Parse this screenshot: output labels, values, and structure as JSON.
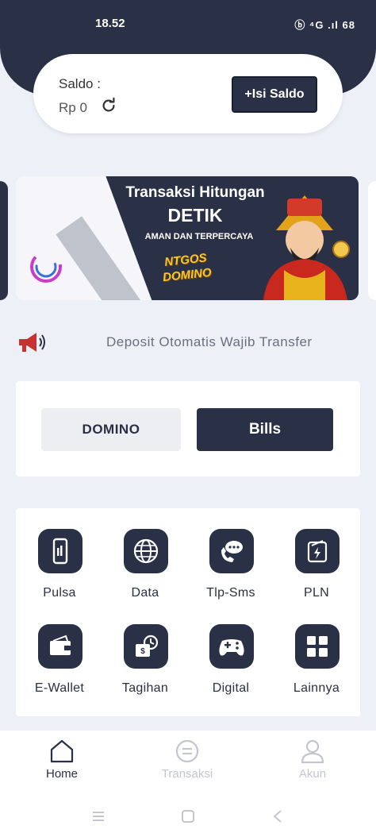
{
  "status_bar": {
    "time": "18.52",
    "icons": "ⓑ ⁴G .ıl 68"
  },
  "saldo": {
    "label": "Saldo :",
    "value": "Rp 0",
    "refresh_icon": "refresh-icon",
    "topup_label": "+Isi Saldo"
  },
  "banner": {
    "title": "Transaksi Hitungan",
    "highlight": "DETIK",
    "subtitle": "AMAN DAN TERPERCAYA",
    "brand_line1": "NTGOS",
    "brand_line2": "DOMINO",
    "accent_color": "#f6c531"
  },
  "announcement": {
    "icon": "megaphone-icon",
    "text": "Deposit Otomatis Wajib Transfer"
  },
  "tabs": [
    {
      "label": "DOMINO",
      "active": false
    },
    {
      "label": "Bills",
      "active": true
    }
  ],
  "menu": [
    {
      "label": "Pulsa",
      "icon": "phone-icon"
    },
    {
      "label": "Data",
      "icon": "globe-icon"
    },
    {
      "label": "Tlp-Sms",
      "icon": "chat-call-icon"
    },
    {
      "label": "PLN",
      "icon": "electricity-icon"
    },
    {
      "label": "E-Wallet",
      "icon": "wallet-icon"
    },
    {
      "label": "Tagihan",
      "icon": "bill-clock-icon"
    },
    {
      "label": "Digital",
      "icon": "gamepad-icon"
    },
    {
      "label": "Lainnya",
      "icon": "grid-icon"
    }
  ],
  "bottom_nav": [
    {
      "label": "Home",
      "icon": "home-icon",
      "active": true
    },
    {
      "label": "Transaksi",
      "icon": "transaction-icon",
      "active": false
    },
    {
      "label": "Akun",
      "icon": "user-icon",
      "active": false
    }
  ],
  "colors": {
    "primary": "#2a3046",
    "background": "#eef0f7"
  }
}
